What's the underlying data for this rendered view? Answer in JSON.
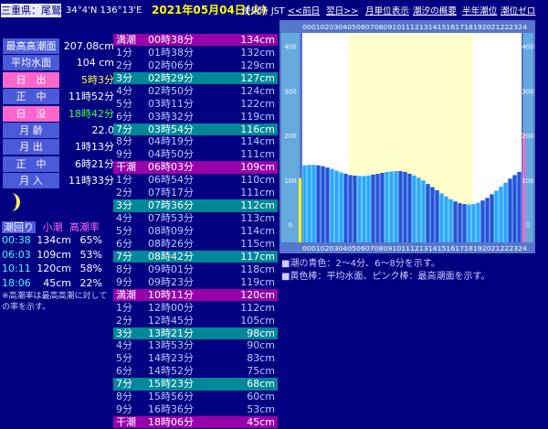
{
  "header": {
    "location": "三重県：尾鷲",
    "coords": "34°4'N 136°13'E",
    "date": "2021年05月04日(火)",
    "timezone": "使用時 JST",
    "nav": [
      "<<前日",
      "翌日>>",
      "月単位表示",
      "潮汐の概要",
      "半年潮位",
      "潮位ゼロ"
    ]
  },
  "info": [
    {
      "label": "最高高潮面",
      "value": "207.08cm",
      "style": "blue",
      "vstyle": ""
    },
    {
      "label": "平均水面",
      "value": "104 cm",
      "style": "blue",
      "vstyle": ""
    },
    {
      "label": "日　出",
      "value": "5時3分",
      "style": "pink",
      "vstyle": "yellow"
    },
    {
      "label": "正　中",
      "value": "11時52分",
      "style": "blue",
      "vstyle": ""
    },
    {
      "label": "日　没",
      "value": "18時42分",
      "style": "pink",
      "vstyle": "green"
    },
    {
      "label": "月 齢",
      "value": "22.0",
      "style": "blue",
      "vstyle": ""
    },
    {
      "label": "月 出",
      "value": "1時13分",
      "style": "blue",
      "vstyle": ""
    },
    {
      "label": "正　中",
      "value": "6時21分",
      "style": "blue",
      "vstyle": ""
    },
    {
      "label": "月 入",
      "value": "11時33分",
      "style": "blue",
      "vstyle": ""
    }
  ],
  "tide_summary": {
    "head": [
      "潮回り",
      "小潮",
      "高潮率"
    ],
    "rows": [
      {
        "time": "00:38",
        "level": "134cm",
        "rate": "65%"
      },
      {
        "time": "06:03",
        "level": "109cm",
        "rate": "53%"
      },
      {
        "time": "10:11",
        "level": "120cm",
        "rate": "58%"
      },
      {
        "time": "18:06",
        "level": "45cm",
        "rate": "22%"
      }
    ],
    "note": "※高潮率は最高高潮に対しての率を示す。"
  },
  "table": [
    {
      "c1": "満潮",
      "c2": "00時38分",
      "c3": "134cm",
      "t": "high"
    },
    {
      "c1": "1分",
      "c2": "01時38分",
      "c3": "132cm",
      "t": "plain"
    },
    {
      "c1": "2分",
      "c2": "02時06分",
      "c3": "129cm",
      "t": "plain"
    },
    {
      "c1": "3分",
      "c2": "02時29分",
      "c3": "127cm",
      "t": "teal"
    },
    {
      "c1": "4分",
      "c2": "02時50分",
      "c3": "124cm",
      "t": "plain"
    },
    {
      "c1": "5分",
      "c2": "03時11分",
      "c3": "122cm",
      "t": "plain"
    },
    {
      "c1": "6分",
      "c2": "03時32分",
      "c3": "119cm",
      "t": "plain"
    },
    {
      "c1": "7分",
      "c2": "03時54分",
      "c3": "116cm",
      "t": "teal"
    },
    {
      "c1": "8分",
      "c2": "04時19分",
      "c3": "114cm",
      "t": "plain"
    },
    {
      "c1": "9分",
      "c2": "04時50分",
      "c3": "111cm",
      "t": "plain"
    },
    {
      "c1": "干潮",
      "c2": "06時03分",
      "c3": "109cm",
      "t": "low"
    },
    {
      "c1": "1分",
      "c2": "06時54分",
      "c3": "110cm",
      "t": "plain"
    },
    {
      "c1": "2分",
      "c2": "07時17分",
      "c3": "111cm",
      "t": "plain"
    },
    {
      "c1": "3分",
      "c2": "07時36分",
      "c3": "112cm",
      "t": "teal"
    },
    {
      "c1": "4分",
      "c2": "07時53分",
      "c3": "113cm",
      "t": "plain"
    },
    {
      "c1": "5分",
      "c2": "08時09分",
      "c3": "114cm",
      "t": "plain"
    },
    {
      "c1": "6分",
      "c2": "08時26分",
      "c3": "115cm",
      "t": "plain"
    },
    {
      "c1": "7分",
      "c2": "08時42分",
      "c3": "117cm",
      "t": "teal"
    },
    {
      "c1": "8分",
      "c2": "09時01分",
      "c3": "118cm",
      "t": "plain"
    },
    {
      "c1": "9分",
      "c2": "09時23分",
      "c3": "119cm",
      "t": "plain"
    },
    {
      "c1": "満潮",
      "c2": "10時11分",
      "c3": "120cm",
      "t": "high"
    },
    {
      "c1": "1分",
      "c2": "12時00分",
      "c3": "112cm",
      "t": "plain"
    },
    {
      "c1": "2分",
      "c2": "12時45分",
      "c3": "105cm",
      "t": "plain"
    },
    {
      "c1": "3分",
      "c2": "13時21分",
      "c3": "98cm",
      "t": "teal"
    },
    {
      "c1": "4分",
      "c2": "13時53分",
      "c3": "90cm",
      "t": "plain"
    },
    {
      "c1": "5分",
      "c2": "14時23分",
      "c3": "83cm",
      "t": "plain"
    },
    {
      "c1": "6分",
      "c2": "14時52分",
      "c3": "75cm",
      "t": "plain"
    },
    {
      "c1": "7分",
      "c2": "15時23分",
      "c3": "68cm",
      "t": "teal"
    },
    {
      "c1": "8分",
      "c2": "15時56分",
      "c3": "60cm",
      "t": "plain"
    },
    {
      "c1": "9分",
      "c2": "16時36分",
      "c3": "53cm",
      "t": "plain"
    },
    {
      "c1": "干潮",
      "c2": "18時06分",
      "c3": "45cm",
      "t": "low"
    }
  ],
  "legend": [
    "■潮の青色：2～4分、6～8分を示す。",
    "■黄色棒：平均水面、ピンク棒：最高潮面を示す。"
  ],
  "colors": {
    "bar": "#2ba8ff",
    "bar_dark": "#2255dd",
    "day": "#ffffcc",
    "night": "#ffffff",
    "pink": "#ff66cc",
    "yellow": "#ffff00"
  },
  "chart_data": {
    "type": "bar",
    "hours_label": "00010203040506070809101112131415161718192021222324",
    "yticks": [
      0,
      100,
      200,
      300,
      400
    ],
    "ylim": [
      -40,
      430
    ],
    "mean_level": 104,
    "max_level": 207.08,
    "sunrise_hour": 5.05,
    "sunset_hour": 18.7,
    "x": [
      0,
      0.5,
      1,
      1.5,
      2,
      2.5,
      3,
      3.5,
      4,
      4.5,
      5,
      5.5,
      6,
      6.5,
      7,
      7.5,
      8,
      8.5,
      9,
      9.5,
      10,
      10.5,
      11,
      11.5,
      12,
      12.5,
      13,
      13.5,
      14,
      14.5,
      15,
      15.5,
      16,
      16.5,
      17,
      17.5,
      18,
      18.5,
      19,
      19.5,
      20,
      20.5,
      21,
      21.5,
      22,
      22.5,
      23,
      23.5,
      24
    ],
    "values": [
      133,
      134,
      134,
      133,
      131,
      128,
      125,
      121,
      117,
      114,
      111,
      110,
      109,
      109,
      110,
      112,
      114,
      116,
      118,
      119,
      120,
      120,
      118,
      114,
      110,
      105,
      99,
      91,
      84,
      77,
      70,
      63,
      57,
      52,
      48,
      46,
      45,
      46,
      49,
      54,
      60,
      68,
      76,
      85,
      94,
      103,
      111,
      118,
      124
    ]
  }
}
